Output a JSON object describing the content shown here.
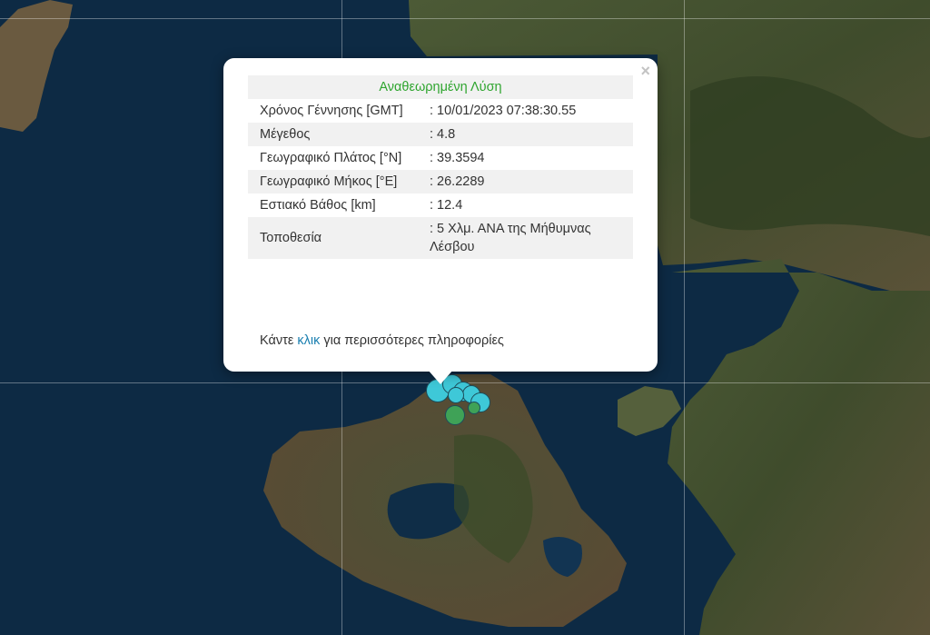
{
  "popup": {
    "close_glyph": "×",
    "title": "Αναθεωρημένη Λύση",
    "title_color": "#2fa52f",
    "rows": [
      {
        "label": "Χρόνος Γέννησης [GMT]",
        "value": ": 10/01/2023 07:38:30.55"
      },
      {
        "label": "Μέγεθος",
        "value": ": 4.8"
      },
      {
        "label": "Γεωγραφικό Πλάτος [°N]",
        "value": ": 39.3594"
      },
      {
        "label": "Γεωγραφικό Μήκος [°E]",
        "value": ": 26.2289"
      },
      {
        "label": "Εστιακό Βάθος [km]",
        "value": ": 12.4"
      },
      {
        "label": "Τοποθεσία",
        "value": ": 5 Χλμ. ΑΝΑ της Μήθυμνας Λέσβου"
      }
    ],
    "more_info_prefix": "Κάντε",
    "more_info_link": "κλικ",
    "more_info_suffix": "για περισσότερες πληροφορίες"
  },
  "map": {
    "sea_color": "#0d2a44",
    "land_color": "#4a4a34",
    "marker_colors": {
      "recent": "#3ec8d8",
      "older": "#3fa257"
    }
  }
}
